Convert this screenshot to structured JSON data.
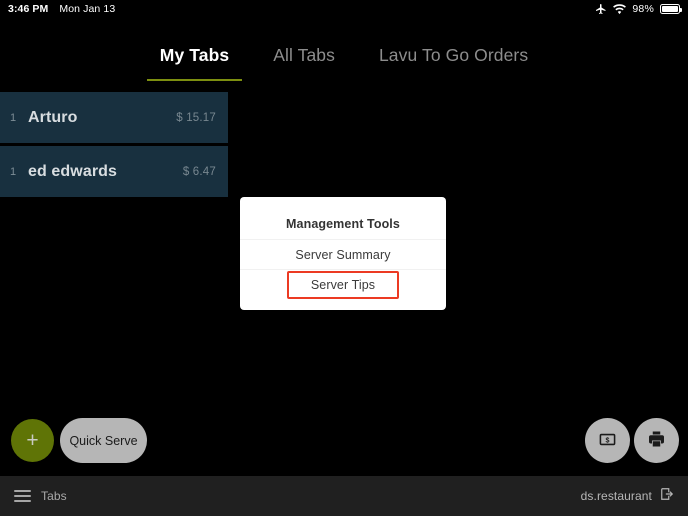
{
  "statusbar": {
    "time": "3:46 PM",
    "date": "Mon Jan 13",
    "battery_percent": "98%",
    "airplane_icon": "airplane-icon",
    "wifi_icon": "wifi-icon",
    "battery_icon": "battery-icon"
  },
  "tabs": {
    "items": [
      {
        "label": "My Tabs",
        "active": true
      },
      {
        "label": "All Tabs",
        "active": false
      },
      {
        "label": "Lavu To Go Orders",
        "active": false
      }
    ],
    "active_underline_color": "#7d8f10"
  },
  "tab_list": {
    "rows": [
      {
        "qty": "1",
        "name": "Arturo",
        "amount": "$ 15.17"
      },
      {
        "qty": "1",
        "name": "ed edwards",
        "amount": "$ 6.47"
      }
    ],
    "row_background": "#18303f"
  },
  "modal": {
    "title": "Management Tools",
    "items": [
      {
        "label": "Server Summary",
        "highlighted": false
      },
      {
        "label": "Server Tips",
        "highlighted": true
      }
    ],
    "highlight_color": "#ec3a23"
  },
  "actions": {
    "add_label": "+",
    "quick_serve_label": "Quick Serve",
    "cash_icon": "cash-drawer-icon",
    "print_icon": "printer-icon",
    "add_button_color": "#5f7406"
  },
  "footer": {
    "menu_icon": "hamburger-menu-icon",
    "menu_label": "Tabs",
    "user_label": "ds.restaurant",
    "logout_icon": "logout-icon"
  }
}
